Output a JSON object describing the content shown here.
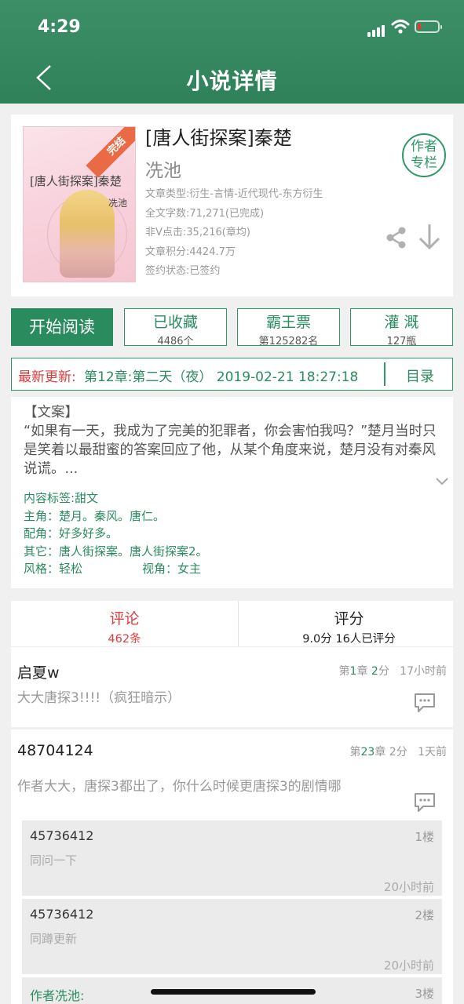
{
  "status_bar": {
    "time": "4:29"
  },
  "header": {
    "title": "小说详情"
  },
  "book": {
    "title": "[唐人街探案]秦楚",
    "author": "冼池",
    "cover": {
      "badge": "完结",
      "title": "[唐人街探案]秦楚",
      "author": "冼池"
    },
    "meta": [
      "文章类型:衍生-言情-近代现代-东方衍生",
      "全文字数:71,271(已完成)",
      "非V点击:35,216(章均)",
      "文章积分:4424.7万",
      "签约状态:已签约"
    ],
    "author_column": {
      "line1": "作者",
      "line2": "专栏"
    }
  },
  "actions": {
    "read": "开始阅读",
    "collect": {
      "label": "已收藏",
      "sub": "4486个"
    },
    "ticket": {
      "label": "霸王票",
      "sub": "第125282名"
    },
    "water": {
      "label": "灌 溉",
      "sub": "127瓶"
    }
  },
  "update": {
    "label": "最新更新:",
    "text": "第12章:第二天（夜） 2019-02-21 18:27:18",
    "toc": "目录"
  },
  "intro": {
    "heading": "【文案】",
    "text": "“如果有一天，我成为了完美的犯罪者，你会害怕我吗？”楚月当时只是笑着以最甜蜜的答案回应了他，从某个角度来说，楚月没有对秦风说谎。...",
    "tags": {
      "content_label": "内容标签:",
      "content": "甜文",
      "lead_label": "主角：",
      "lead": "楚月。秦风。唐仁。",
      "support_label": "配角：",
      "support": "好多好多。",
      "other_label": "其它：",
      "other": "唐人街探案。唐人街探案2。",
      "style_label": "风格：",
      "style": "轻松",
      "view_label": "视角：",
      "view": "女主"
    }
  },
  "tabs": {
    "comments": {
      "label": "评论",
      "sub": "462条",
      "color": "#e03c3c"
    },
    "rating": {
      "label": "评分",
      "sub": "9.0分 16人已评分"
    }
  },
  "comments": [
    {
      "user": "启夏w",
      "ch_pre": "第",
      "ch": "1",
      "ch_mid": "章",
      "score": "2",
      "score_unit": "分",
      "time": "17小时前",
      "text": "大大唐探3!!!!（疯狂暗示）"
    },
    {
      "user": "48704124",
      "ch_pre": "第",
      "ch": "23",
      "ch_mid": "章",
      "score": "2",
      "score_unit": "分",
      "time": "1天前",
      "text": "作者大大，唐探3都出了，你什么时候更唐探3的剧情哪",
      "replies": [
        {
          "user": "45736412",
          "floor": "1楼",
          "text": "同问一下",
          "time": "20小时前"
        },
        {
          "user": "45736412",
          "floor": "2楼",
          "text": "同蹲更新",
          "time": "20小时前"
        },
        {
          "user": "作者冼池:",
          "floor": "3楼"
        }
      ]
    }
  ]
}
